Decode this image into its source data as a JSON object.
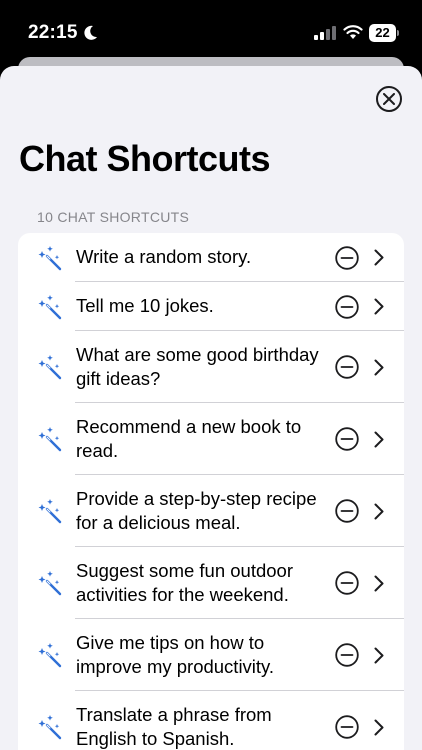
{
  "status": {
    "time": "22:15",
    "battery": "22"
  },
  "page": {
    "title": "Chat Shortcuts",
    "section_header": "10 CHAT SHORTCUTS"
  },
  "shortcuts": [
    {
      "label": "Write a random story."
    },
    {
      "label": "Tell me 10 jokes."
    },
    {
      "label": "What are some good birthday gift ideas?"
    },
    {
      "label": "Recommend a new book to read."
    },
    {
      "label": "Provide a step-by-step recipe for a delicious meal."
    },
    {
      "label": "Suggest some fun outdoor activities for the weekend."
    },
    {
      "label": "Give me tips on how to improve my productivity."
    },
    {
      "label": "Translate a phrase from English to Spanish."
    }
  ],
  "icons": {
    "shortcut": "magic-wand-icon",
    "remove": "minus-circle-icon",
    "disclosure": "chevron-right-icon",
    "close": "x-circle-icon"
  },
  "colors": {
    "accent": "#2f6fd6",
    "sheet_background": "#f2f2f7",
    "secondary_text": "#86868b"
  }
}
